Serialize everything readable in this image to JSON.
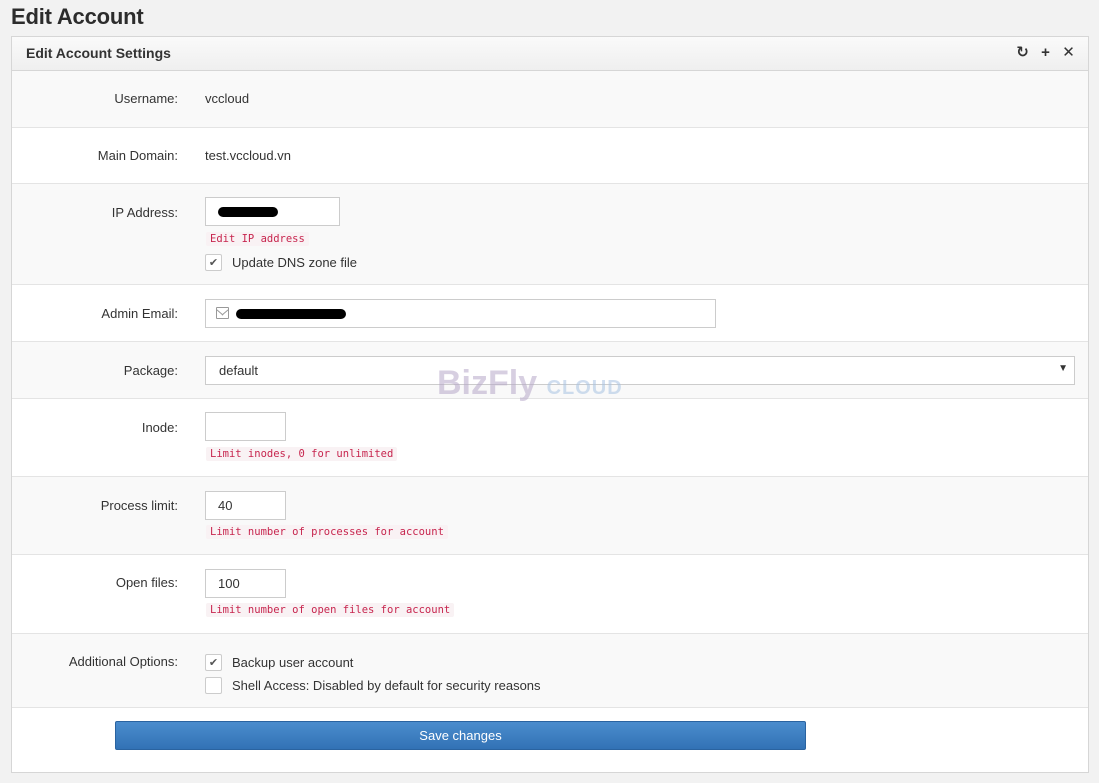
{
  "page": {
    "title": "Edit Account"
  },
  "panel": {
    "title": "Edit Account Settings",
    "tools": {
      "refresh_icon": "refresh-icon",
      "expand_icon": "plus-icon",
      "close_icon": "close-icon"
    }
  },
  "form": {
    "username": {
      "label": "Username:",
      "value": "vccloud"
    },
    "main_domain": {
      "label": "Main Domain:",
      "value": "test.vccloud.vn"
    },
    "ip_address": {
      "label": "IP Address:",
      "hint": "Edit IP address",
      "update_dns_label": "Update DNS zone file",
      "update_dns_checked": true,
      "value_redacted": true
    },
    "admin_email": {
      "label": "Admin Email:",
      "icon": "envelope-icon",
      "value_redacted": true
    },
    "package": {
      "label": "Package:",
      "selected": "default"
    },
    "inode": {
      "label": "Inode:",
      "value": "",
      "hint": "Limit inodes, 0 for unlimited"
    },
    "process_limit": {
      "label": "Process limit:",
      "value": "40",
      "hint": "Limit number of processes for account"
    },
    "open_files": {
      "label": "Open files:",
      "value": "100",
      "hint": "Limit number of open files for account"
    },
    "additional_options": {
      "label": "Additional Options:",
      "options": [
        {
          "label": "Backup user account",
          "checked": true
        },
        {
          "label": "Shell Access: Disabled by default for security reasons",
          "checked": false
        }
      ]
    }
  },
  "actions": {
    "save_label": "Save changes"
  },
  "watermark": {
    "brand": "BizFly",
    "suffix": "CLOUD"
  },
  "colors": {
    "primary_button": "#3a7bbf",
    "hint_text": "#c7254e",
    "hint_bg": "#f9f2f4"
  }
}
